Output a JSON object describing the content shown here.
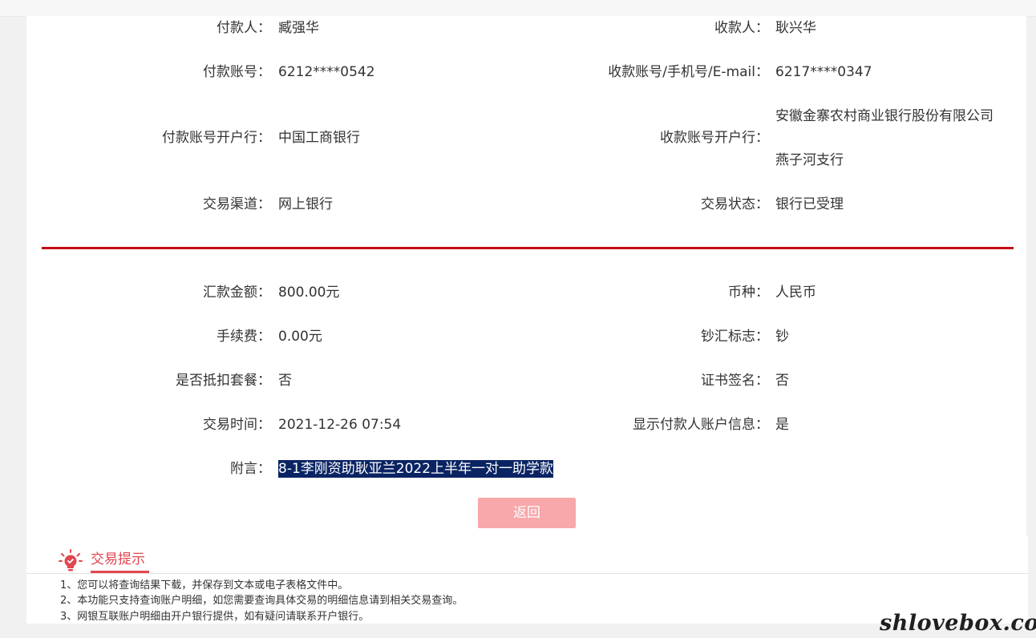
{
  "transfer": {
    "payer_label": "付款人：",
    "payer_value": "臧强华",
    "payee_label": "收款人：",
    "payee_value": "耿兴华",
    "payer_account_label": "付款账号：",
    "payer_account_value": "6212****0542",
    "payee_account_label": "收款账号/手机号/E-mail：",
    "payee_account_value": "6217****0347",
    "payer_bank_label": "付款账号开户行：",
    "payer_bank_value": "中国工商银行",
    "payee_bank_label": "收款账号开户行：",
    "payee_bank_value_line1": "安徽金寨农村商业银行股份有限公司",
    "payee_bank_value_line2": "燕子河支行",
    "channel_label": "交易渠道：",
    "channel_value": "网上银行",
    "status_label": "交易状态：",
    "status_value": "银行已受理"
  },
  "details": {
    "amount_label": "汇款金额：",
    "amount_value": "800.00元",
    "currency_label": "币种：",
    "currency_value": "人民币",
    "fee_label": "手续费：",
    "fee_value": "0.00元",
    "cash_flag_label": "钞汇标志：",
    "cash_flag_value": "钞",
    "package_label": "是否抵扣套餐：",
    "package_value": "否",
    "cert_label": "证书签名：",
    "cert_value": "否",
    "time_label": "交易时间：",
    "time_value": "2021-12-26 07:54",
    "show_payer_label": "显示付款人账户信息：",
    "show_payer_value": "是",
    "memo_label": "附言：",
    "memo_value": "8-1李刚资助耿亚兰2022上半年一对一助学款"
  },
  "actions": {
    "return_label": "返回"
  },
  "tips": {
    "title": "交易提示",
    "lines": [
      "1、您可以将查询结果下载，并保存到文本或电子表格文件中。",
      "2、本功能只支持查询账户明细，如您需要查询具体交易的明细信息请到相关交易查询。",
      "3、网银互联账户明细由开户银行提供，如有疑问请联系开户银行。"
    ]
  },
  "watermark": "shlovebox.com",
  "colors": {
    "divider_red": "#c20e13",
    "button_pink": "#f8a7aa",
    "tips_red": "#e0474f",
    "memo_highlight": "#0a2463"
  }
}
